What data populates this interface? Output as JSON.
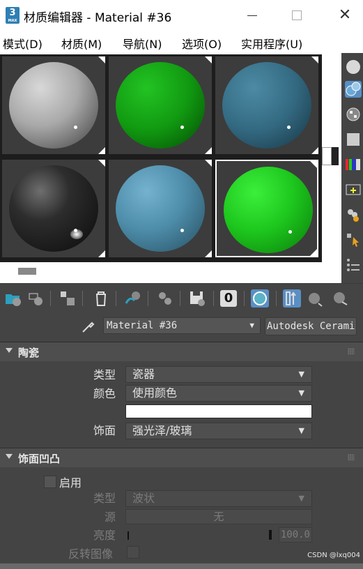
{
  "window": {
    "title": "材质编辑器 - Material #36",
    "app_icon_text": "3",
    "app_icon_sub": "MAX"
  },
  "menu": [
    "模式(D)",
    "材质(M)",
    "导航(N)",
    "选项(O)",
    "实用程序(U)"
  ],
  "slots": [
    {
      "name": "slot-1",
      "color": "#a9a9a9"
    },
    {
      "name": "slot-2",
      "color": "#119a11"
    },
    {
      "name": "slot-3",
      "color": "#336a82"
    },
    {
      "name": "slot-4",
      "color": "#2d2d2d"
    },
    {
      "name": "slot-5",
      "color": "#4f8eab"
    },
    {
      "name": "slot-6",
      "color": "#1ec81e"
    }
  ],
  "toolbar": {
    "material_id_channel": "0"
  },
  "material": {
    "name": "Material #36",
    "type_button": "Autodesk Cerami"
  },
  "ceramic": {
    "title": "陶瓷",
    "type_label": "类型",
    "type_value": "瓷器",
    "color_label": "颜色",
    "color_value": "使用颜色",
    "color_swatch": "#ffffff",
    "finish_label": "饰面",
    "finish_value": "强光泽/玻璃"
  },
  "bump": {
    "title": "饰面凹凸",
    "enable_label": "启用",
    "type_label": "类型",
    "type_value": "波状",
    "source_label": "源",
    "source_value": "无",
    "amount_label": "亮度",
    "amount_value": "100.0",
    "invert_label": "反转图像"
  },
  "watermark": "CSDN @lxq004",
  "accent": "#5a8fc4"
}
